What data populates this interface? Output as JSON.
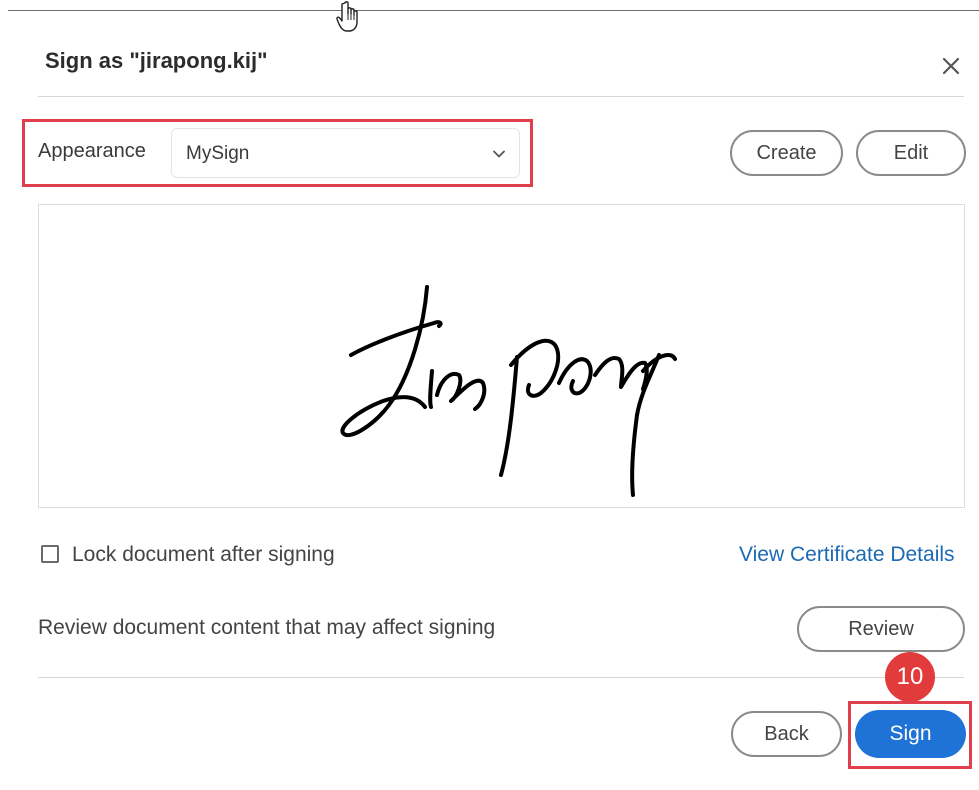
{
  "dialog": {
    "title": "Sign as \"jirapong.kij\"",
    "close_icon": "close-icon"
  },
  "appearance": {
    "label": "Appearance",
    "selected": "MySign",
    "create_label": "Create",
    "edit_label": "Edit"
  },
  "signature": {
    "image_text": "JirapOng"
  },
  "options": {
    "lock_label": "Lock document after signing",
    "lock_checked": false,
    "cert_link": "View Certificate Details",
    "review_text": "Review document content that may affect signing",
    "review_label": "Review"
  },
  "footer": {
    "back_label": "Back",
    "sign_label": "Sign"
  },
  "annotation": {
    "step_number": "10",
    "highlight_color": "#e0404c"
  },
  "colors": {
    "accent": "#1f73d6",
    "link": "#1c6ab4",
    "badge": "#e23b3b"
  }
}
